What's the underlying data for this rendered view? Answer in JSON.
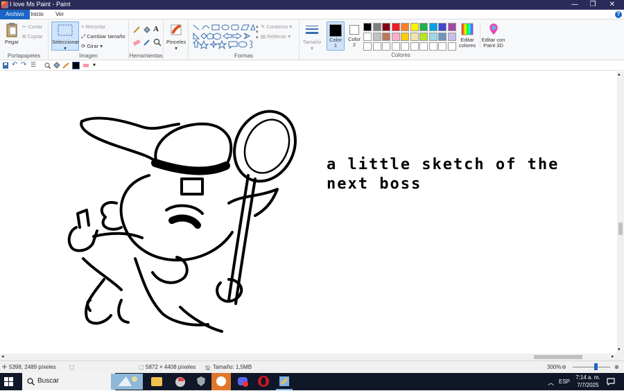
{
  "window": {
    "title": "I love Ms Paint - Paint",
    "minimize": "—",
    "maximize": "❐",
    "close": "✕"
  },
  "tabs": [
    {
      "label": "Archivo"
    },
    {
      "label": "Inicio"
    },
    {
      "label": "Ver"
    }
  ],
  "help": "?",
  "ribbon": {
    "portapapeles": {
      "label": "Portapapeles",
      "pegar": "Pegar",
      "cortar": "Cortar",
      "copiar": "Copiar"
    },
    "imagen": {
      "label": "Imagen",
      "seleccionar": "Seleccionar",
      "recortar": "Recortar",
      "cambiar_tamano": "Cambiar tamaño",
      "girar": "Girar"
    },
    "herramientas": {
      "label": "Herramientas"
    },
    "pinceles": "Pinceles",
    "formas": {
      "label": "Formas",
      "contorno": "Contorno",
      "rellenar": "Rellenar"
    },
    "tamano": "Tamaño",
    "color1": "Color 1",
    "color2": "Color 2",
    "colores": {
      "label": "Colores"
    },
    "editar_colores": "Editar colores",
    "editar_paint3d": "Editar con Paint 3D",
    "palette_row1": [
      "#000000",
      "#7f7f7f",
      "#880015",
      "#ed1c24",
      "#ff7f27",
      "#fff200",
      "#22b14c",
      "#00a2e8",
      "#3f48cc",
      "#a349a4"
    ],
    "palette_row2": [
      "#ffffff",
      "#c3c3c3",
      "#b97a57",
      "#ffaec9",
      "#ffc90e",
      "#efe4b0",
      "#b5e61d",
      "#99d9ea",
      "#7092be",
      "#c8bfe7"
    ],
    "palette_row3": [
      "#ffffff",
      "#ffffff",
      "#ffffff",
      "#ffffff",
      "#ffffff",
      "#ffffff",
      "#ffffff",
      "#ffffff",
      "#ffffff",
      "#ffffff"
    ]
  },
  "canvas": {
    "text": "a little sketch of the\nnext boss"
  },
  "status": {
    "cursor": "5398, 2489 píxeles",
    "dimensions": "5872 × 4408 píxeles",
    "size": "Tamaño: 1,5MB",
    "zoom": "300%"
  },
  "taskbar": {
    "search": "Buscar",
    "lang": "ESP",
    "time": "7:14 a. m.",
    "date": "7/7/2025"
  }
}
